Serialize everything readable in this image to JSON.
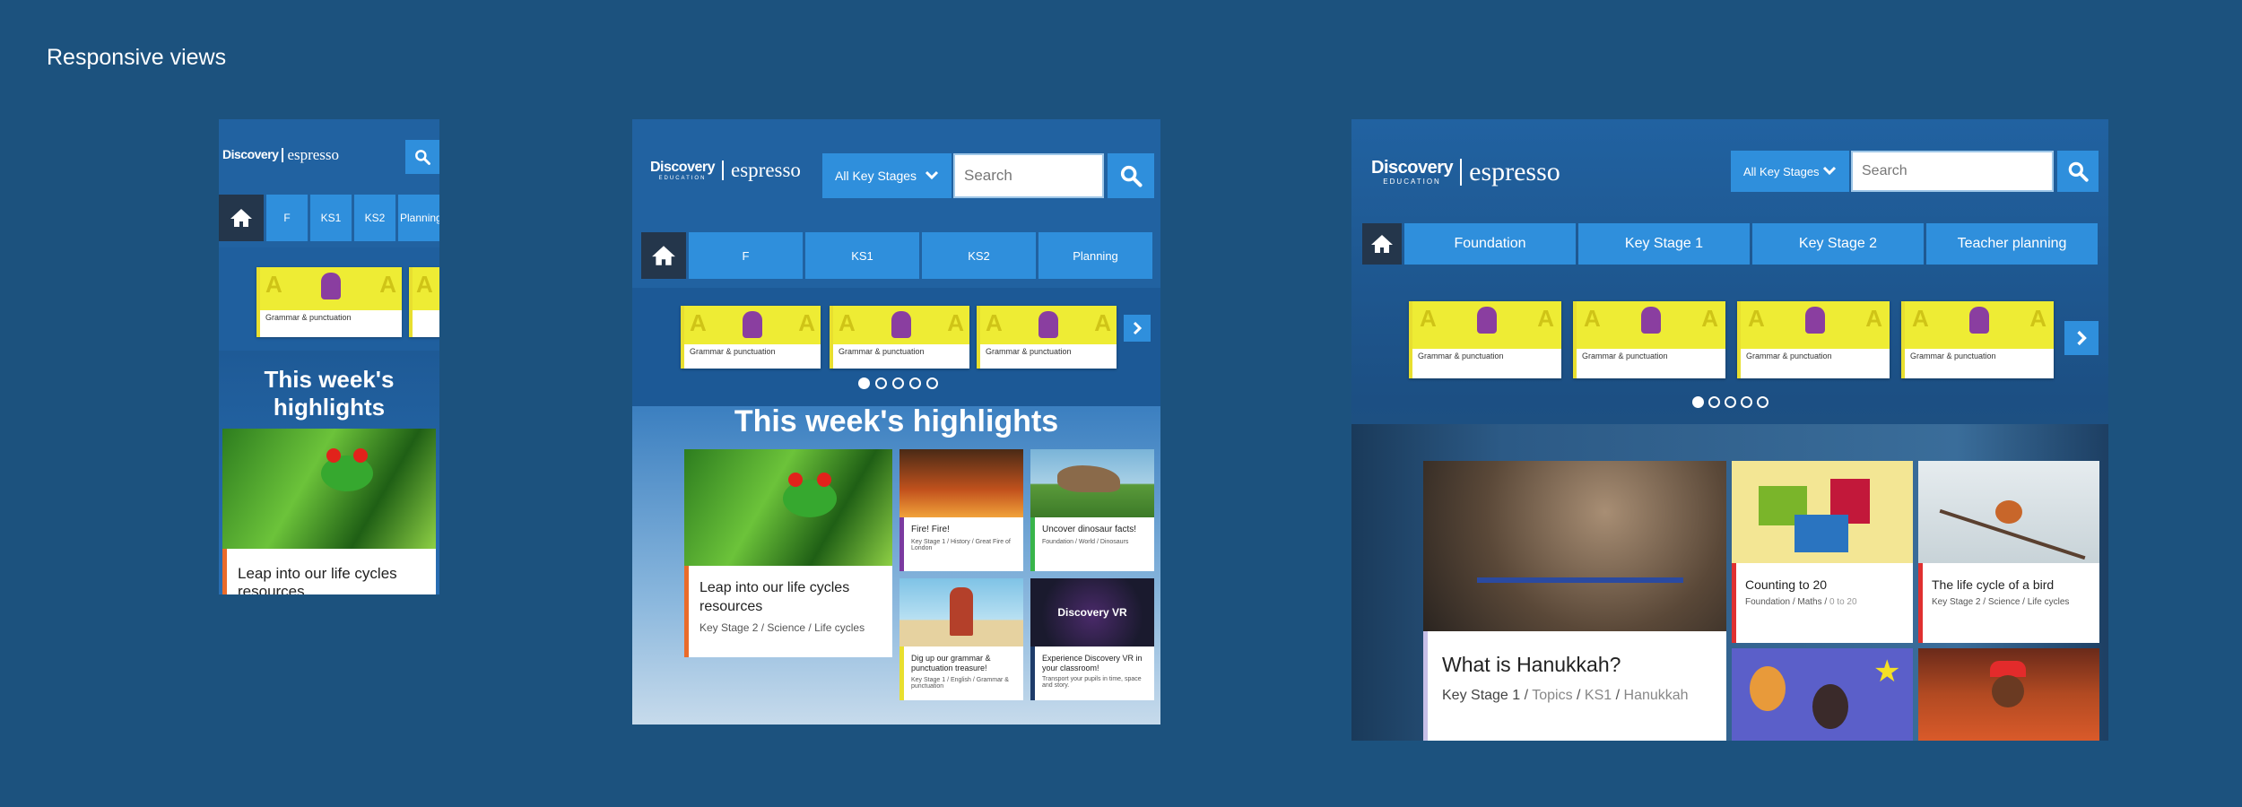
{
  "page_title": "Responsive views",
  "brand": {
    "discovery": "Discovery",
    "education": "EDUCATION",
    "espresso": "espresso"
  },
  "search": {
    "placeholder": "Search",
    "key_stage_select": "All Key Stages"
  },
  "nav_short": [
    "F",
    "KS1",
    "KS2",
    "Planning"
  ],
  "nav_long": [
    "Foundation",
    "Key Stage 1",
    "Key Stage 2",
    "Teacher planning"
  ],
  "carousel_label": "Grammar & punctuation",
  "highlights_title": "This week's highlights",
  "highlights_title_line1": "This week's",
  "highlights_title_line2": "highlights",
  "tiles": {
    "frog": {
      "title": "Leap into our life cycles resources",
      "title_short": "Leap into our life cycles",
      "title_short2": "resources",
      "meta": "Key Stage 2 / Science / Life cycles"
    },
    "fire": {
      "title": "Fire! Fire!",
      "meta": "Key Stage 1 / History / Great Fire of London"
    },
    "dino": {
      "title": "Uncover dinosaur facts!",
      "meta": "Foundation / World / Dinosaurs"
    },
    "grammar": {
      "title": "Dig up our grammar & punctuation treasure!",
      "meta": "Key Stage 1 / English / Grammar & punctuation"
    },
    "vr": {
      "title": "Experience Discovery VR in your classroom!",
      "meta": "Transport your pupils in time, space and story.",
      "logo": "Discovery VR"
    },
    "hanukkah": {
      "title": "What is Hanukkah?",
      "ks": "Key Stage 1",
      "sep": " / ",
      "topics": "Topics",
      "ks1": "KS1",
      "hanukkah": "Hanukkah"
    },
    "counting": {
      "title": "Counting to 20",
      "meta_a": "Foundation / Maths / ",
      "meta_b": "0 to 20"
    },
    "bird": {
      "title": "The life cycle of a bird",
      "meta": "Key Stage 2 / Science / Life cycles"
    }
  },
  "colors": {
    "background": "#1c527e",
    "frame": "#2162a1",
    "button": "#2f8fdc",
    "home": "#24364b",
    "card_yellow": "#eeec34"
  },
  "icons": [
    "search-icon",
    "home-icon",
    "chevron-down-icon",
    "chevron-right-icon"
  ]
}
